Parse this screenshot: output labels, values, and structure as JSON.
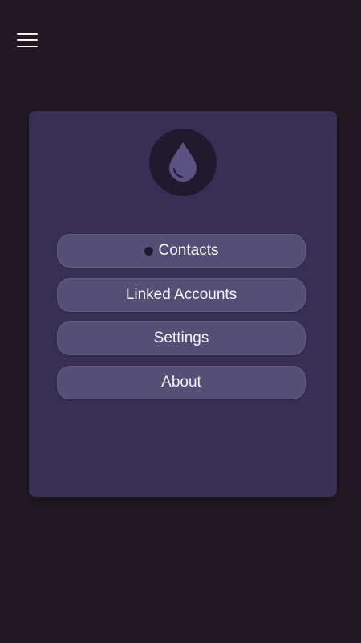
{
  "header": {
    "menu_icon": "hamburger-menu-icon"
  },
  "logo": {
    "icon": "water-drop-icon"
  },
  "menu": {
    "items": [
      {
        "label": "Contacts",
        "badge": "notification-dot"
      },
      {
        "label": "Linked Accounts"
      },
      {
        "label": "Settings"
      },
      {
        "label": "About"
      }
    ]
  },
  "colors": {
    "background": "#221923",
    "panel": "#382f55",
    "button": "#554f76",
    "logo_circle": "#211a2f",
    "drop": "#5a5382",
    "text": "#f5f3f8"
  }
}
